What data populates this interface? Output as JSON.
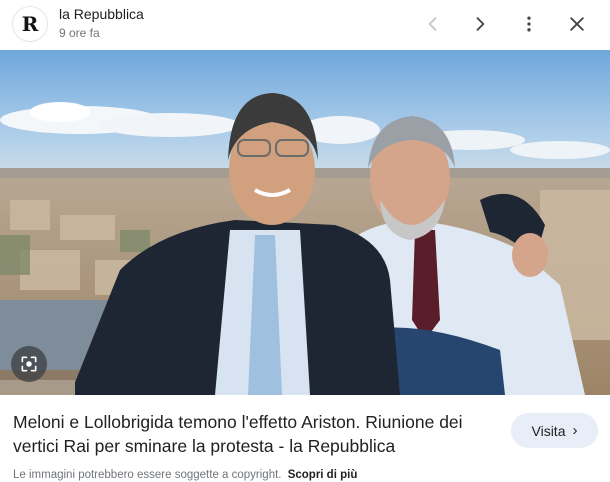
{
  "header": {
    "logo_letter": "R",
    "source_name": "la Repubblica",
    "time_ago": "9 ore fa"
  },
  "icons": {
    "prev": "chevron-left-icon",
    "next": "chevron-right-icon",
    "more": "more-vert-icon",
    "close": "close-icon",
    "lens": "lens-icon"
  },
  "article": {
    "title": "Meloni e Lollobrigida temono l'effetto Ariston. Riunione dei vertici Rai per sminare la protesta - la Repubblica"
  },
  "visit_button": {
    "label": "Visita",
    "chevron": "›"
  },
  "copyright": {
    "notice": "Le immagini potrebbero essere soggette a copyright.",
    "learn_more": "Scopri di più"
  },
  "colors": {
    "sky": "#86b5e2",
    "accent_button": "#e8eef8",
    "jacket_dark": "#1f2633",
    "shirt_light": "#dfe8f3",
    "tie_burgundy": "#5a1e2a"
  }
}
